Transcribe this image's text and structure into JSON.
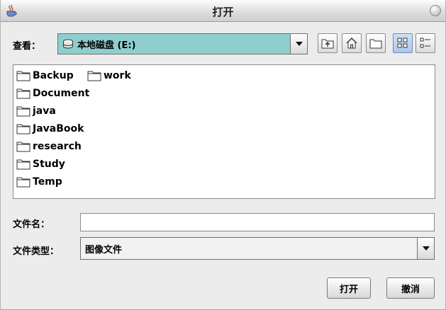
{
  "window": {
    "title": "打开"
  },
  "toolbar": {
    "look_in_label": "查看：",
    "look_in_value": "本地磁盘 (E:)",
    "buttons": [
      "up-folder",
      "home",
      "new-folder",
      "list-view",
      "details-view"
    ]
  },
  "files": [
    {
      "name": "Backup"
    },
    {
      "name": "work"
    },
    {
      "name": "Document"
    },
    {
      "name": "java"
    },
    {
      "name": "JavaBook"
    },
    {
      "name": "research"
    },
    {
      "name": "Study"
    },
    {
      "name": "Temp"
    }
  ],
  "form": {
    "filename_label": "文件名：",
    "filename_value": "",
    "filetype_label": "文件类型：",
    "filetype_value": "图像文件"
  },
  "actions": {
    "open_label": "打开",
    "cancel_label": "撤消"
  },
  "colors": {
    "combo_bg": "#8ecece",
    "active_view": "#aec8e8"
  }
}
